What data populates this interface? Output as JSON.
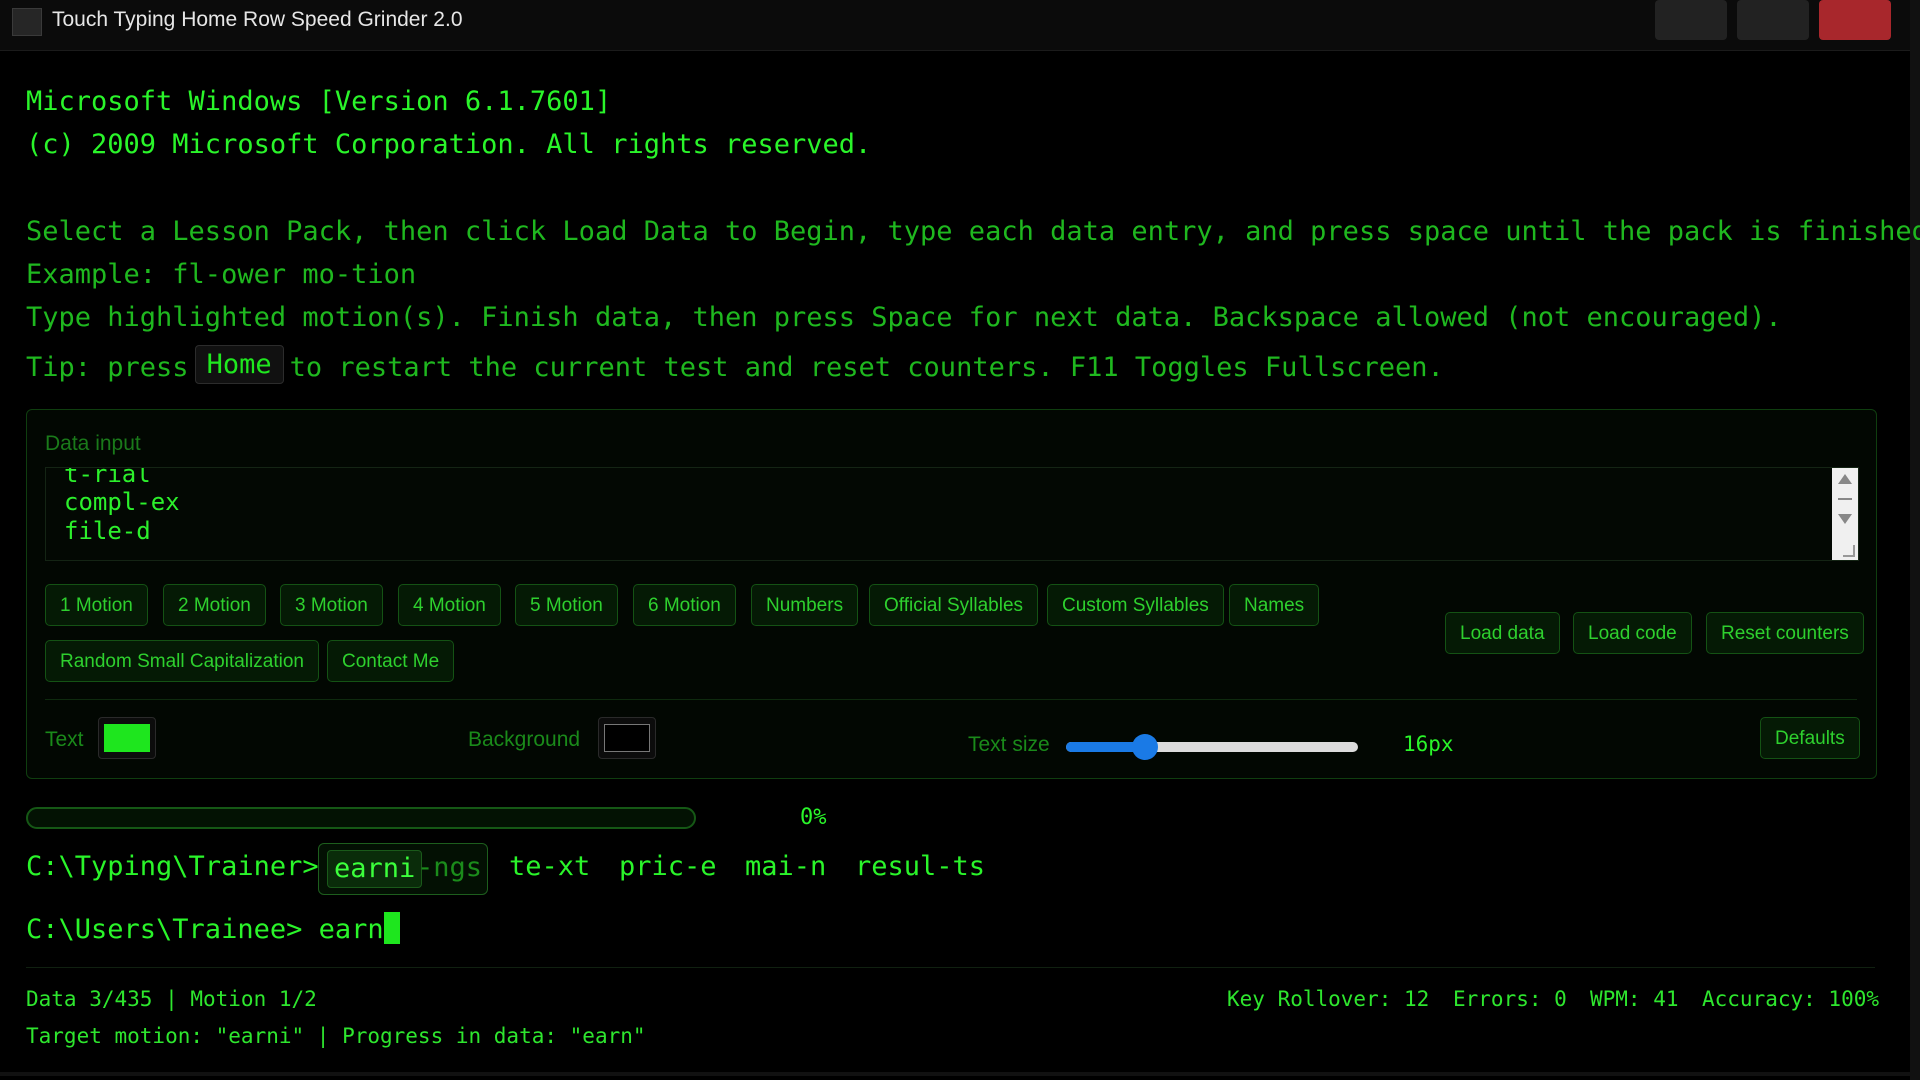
{
  "window": {
    "title": "Touch Typing Home Row Speed Grinder 2.0"
  },
  "console": {
    "header_line1": "Microsoft Windows [Version 6.1.7601]",
    "header_line2": "(c) 2009 Microsoft Corporation. All rights reserved.",
    "instructions": [
      "Select a Lesson Pack, then click Load Data to Begin, type each data entry, and press space until the pack is finished.",
      "Example: fl-ower mo-tion",
      "Type highlighted motion(s). Finish data, then press Space for next data. Backspace allowed (not encouraged)."
    ],
    "tip_prefix": "Tip: press",
    "tip_key": "Home",
    "tip_suffix": "to restart the current test and reset counters. F11 Toggles Fullscreen."
  },
  "panel": {
    "label": "Data input",
    "textarea_lines": [
      "t-rial",
      "compl-ex",
      "file-d"
    ],
    "lesson_buttons": [
      "1 Motion",
      "2 Motion",
      "3 Motion",
      "4 Motion",
      "5 Motion",
      "6 Motion",
      "Numbers",
      "Official Syllables",
      "Custom Syllables",
      "Names"
    ],
    "extra_buttons": [
      "Random Small Capitalization",
      "Contact Me"
    ],
    "action_buttons": [
      "Load data",
      "Load code",
      "Reset counters"
    ],
    "text_label": "Text",
    "text_color": "#1ee61e",
    "background_label": "Background",
    "background_color": "#000000",
    "text_size_label": "Text size",
    "text_size_value": "16px",
    "text_size_fraction": 0.27,
    "defaults_button": "Defaults"
  },
  "progress": {
    "value": 0,
    "label": "0%"
  },
  "prompts": {
    "trainer_prompt": "C:\\Typing\\Trainer>",
    "current_motion": "earni",
    "current_rest": "-ngs",
    "upcoming": [
      "te-xt",
      "pric-e",
      "mai-n",
      "resul-ts"
    ],
    "user_prompt": "C:\\Users\\Trainee>",
    "typed": "earn"
  },
  "status": {
    "left_line1": "Data 3/435 | Motion 1/2",
    "left_line2": "Target motion: \"earni\" | Progress in data: \"earn\"",
    "key_rollover": "Key Rollover: 12",
    "errors": "Errors: 0",
    "wpm": "WPM: 41",
    "accuracy": "Accuracy: 100%"
  },
  "colors": {
    "accent": "#1ee61e",
    "close_button": "#a8272c",
    "slider": "#1a7ae6"
  }
}
